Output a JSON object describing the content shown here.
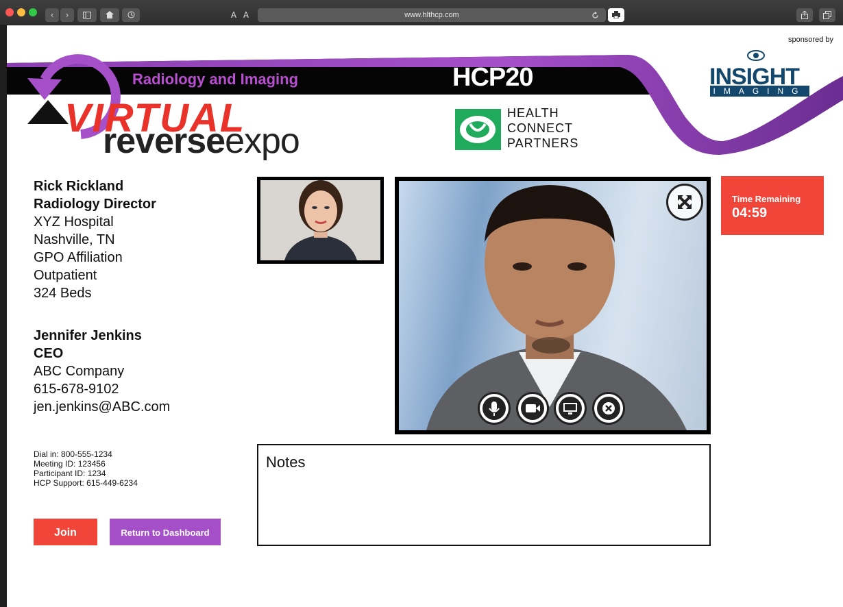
{
  "browser": {
    "url": "www.hlthcp.com",
    "font_small": "A",
    "font_large": "A"
  },
  "banner": {
    "sponsored_by": "sponsored by",
    "event_title_top": "VIRTUAL",
    "event_title_reverse": "reverse",
    "event_title_expo": "expo",
    "subtitle": "Radiology and Imaging",
    "event_code": "HCP20",
    "partner_line1": "HEALTH",
    "partner_line2": "CONNECT",
    "partner_line3": "PARTNERS",
    "sponsor_name": "INSIGHT",
    "sponsor_sub": "IMAGING",
    "colors": {
      "purple": "#a54fc9",
      "red": "#e8322a",
      "green": "#1fab5b",
      "navy": "#13476b"
    }
  },
  "attendee": {
    "name": "Rick Rickland",
    "title": "Radiology Director",
    "organization": "XYZ Hospital",
    "location": "Nashville, TN",
    "affiliation": "GPO Affiliation",
    "setting": "Outpatient",
    "beds": "324 Beds"
  },
  "vendor": {
    "name": "Jennifer Jenkins",
    "title": "CEO",
    "company": "ABC Company",
    "phone": "615-678-9102",
    "email": "jen.jenkins@ABC.com"
  },
  "dial_info": {
    "dial_in": "Dial in: 800-555-1234",
    "meeting_id": "Meeting ID: 123456",
    "participant_id": "Participant ID: 1234",
    "support": "HCP Support: 615-449-6234"
  },
  "buttons": {
    "join": "Join",
    "dashboard": "Return to Dashboard"
  },
  "timer": {
    "label": "Time Remaining",
    "value": "04:59"
  },
  "notes": {
    "title": "Notes",
    "value": ""
  },
  "video_controls": [
    "microphone-icon",
    "camera-icon",
    "screen-share-icon",
    "end-call-icon"
  ]
}
